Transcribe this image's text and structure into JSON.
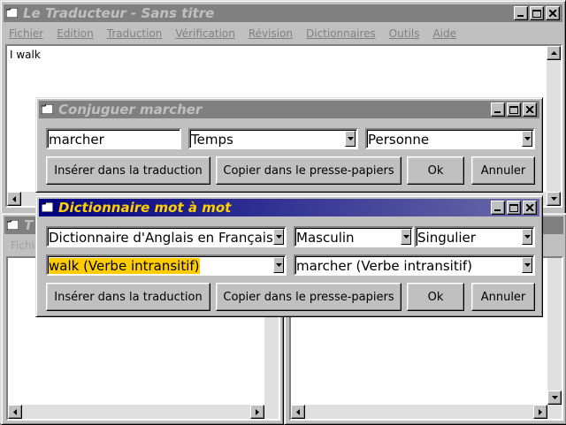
{
  "main": {
    "title": "Le Traducteur - Sans titre",
    "menu": [
      "Fichier",
      "Edition",
      "Traduction",
      "Vérification",
      "Révision",
      "Dictionnaires",
      "Outils",
      "Aide"
    ],
    "doc_text": "I walk"
  },
  "behind": {
    "left_title": "T",
    "left_menu": "Fichie"
  },
  "conjuguer": {
    "title": "Conjuguer marcher",
    "verb": "marcher",
    "temps": "Temps",
    "personne": "Personne",
    "btn_insert": "Insérer dans la traduction",
    "btn_copy": "Copier dans le presse-papiers",
    "btn_ok": "Ok",
    "btn_cancel": "Annuler"
  },
  "dico": {
    "title": "Dictionnaire mot à mot",
    "dictionary": "Dictionnaire d'Anglais en Français",
    "gender": "Masculin",
    "number": "Singulier",
    "source": "walk  (Verbe intransitif)",
    "target": "marcher  (Verbe intransitif)",
    "btn_insert": "Insérer dans la traduction",
    "btn_copy": "Copier dans le presse-papiers",
    "btn_ok": "Ok",
    "btn_cancel": "Annuler"
  },
  "colors": {
    "active_title_text": "#ffd000",
    "inactive_title": "#808080",
    "highlight": "#ffcc00"
  }
}
